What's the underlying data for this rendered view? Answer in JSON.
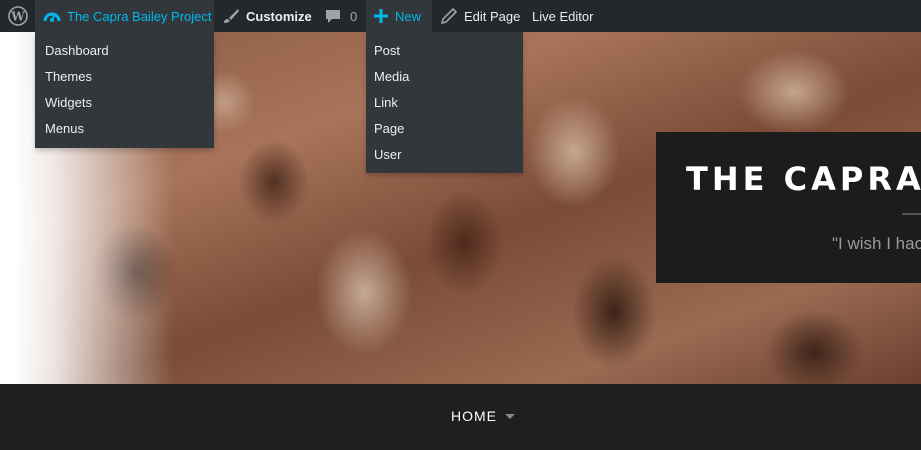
{
  "adminbar": {
    "wp_logo_icon": "wordpress-icon",
    "site_name": "The Capra Bailey Project",
    "customize": "Customize",
    "comments_count": "0",
    "new_label": "New",
    "edit_page": "Edit Page",
    "live_editor": "Live Editor",
    "colors": {
      "bar": "#23282d",
      "hover": "#32373c",
      "accent": "#00b9eb"
    }
  },
  "site_menu": {
    "items": [
      "Dashboard",
      "Themes",
      "Widgets",
      "Menus"
    ]
  },
  "new_menu": {
    "items": [
      "Post",
      "Media",
      "Link",
      "Page",
      "User"
    ]
  },
  "hero": {
    "title": "THE CAPRA B",
    "tagline": "\"I wish I hac"
  },
  "nav": {
    "home": "HOME"
  }
}
